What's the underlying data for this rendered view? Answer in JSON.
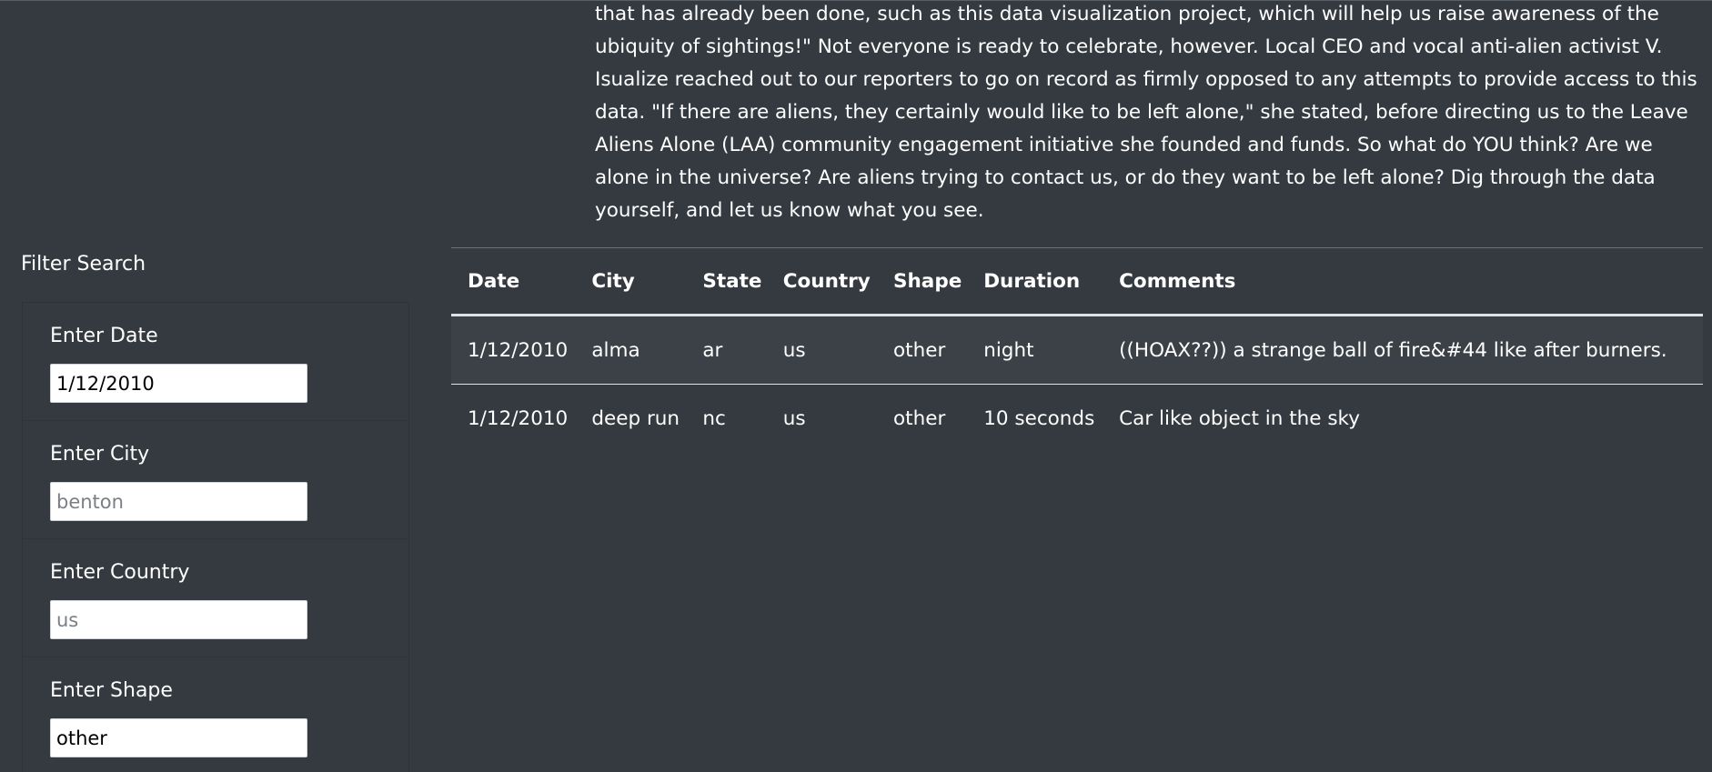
{
  "article": {
    "text": "that has already been done, such as this data visualization project, which will help us raise awareness of the ubiquity of sightings!\" Not everyone is ready to celebrate, however. Local CEO and vocal anti-alien activist V. Isualize reached out to our reporters to go on record as firmly opposed to any attempts to provide access to this data. \"If there are aliens, they certainly would like to be left alone,\" she stated, before directing us to the Leave Aliens Alone (LAA) community engagement initiative she founded and funds. So what do YOU think? Are we alone in the universe? Are aliens trying to contact us, or do they want to be left alone? Dig through the data yourself, and let us know what you see."
  },
  "sidebar": {
    "title": "Filter Search",
    "filters": [
      {
        "label": "Enter Date",
        "value": "1/12/2010",
        "placeholder": ""
      },
      {
        "label": "Enter City",
        "value": "",
        "placeholder": "benton"
      },
      {
        "label": "Enter Country",
        "value": "",
        "placeholder": "us"
      },
      {
        "label": "Enter Shape",
        "value": "other",
        "placeholder": ""
      }
    ]
  },
  "table": {
    "headers": [
      "Date",
      "City",
      "State",
      "Country",
      "Shape",
      "Duration",
      "Comments"
    ],
    "rows": [
      [
        "1/12/2010",
        "alma",
        "ar",
        "us",
        "other",
        "night",
        "((HOAX??)) a strange ball of fire&#44 like after burners."
      ],
      [
        "1/12/2010",
        "deep run",
        "nc",
        "us",
        "other",
        "10 seconds",
        "Car like object in the sky"
      ]
    ]
  }
}
